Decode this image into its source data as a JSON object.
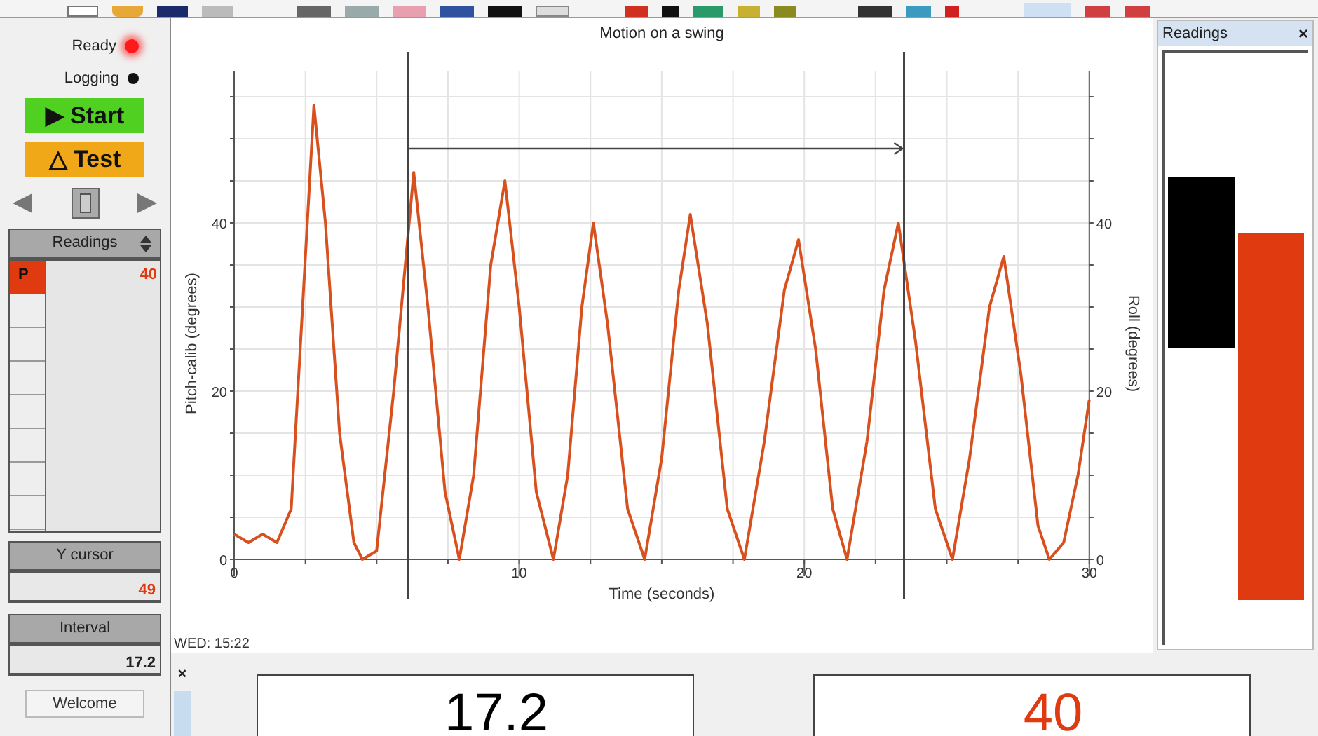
{
  "status_lights": [
    {
      "label": "Ready",
      "on": true
    },
    {
      "label": "Logging",
      "on": false
    }
  ],
  "start_button": {
    "label": "▶ Start"
  },
  "test_button": {
    "label": "△ Test"
  },
  "readings_selector": {
    "label": "Readings"
  },
  "readings_list": [
    {
      "tag": "P",
      "value": "40",
      "color": "#e03a10"
    }
  ],
  "y_cursor": {
    "label": "Y cursor",
    "value": "49"
  },
  "interval": {
    "label": "Interval",
    "value": "17.2"
  },
  "welcome_button": {
    "label": "Welcome"
  },
  "chart_data": {
    "type": "line",
    "title": "Motion on a swing",
    "xlabel": "Time (seconds)",
    "ylabel": "Pitch-calib (degrees)",
    "y2label": "Roll (degrees)",
    "xlim": [
      0,
      30
    ],
    "ylim": [
      0,
      60
    ],
    "xticks": [
      0,
      10,
      20,
      30
    ],
    "yticks": [
      0,
      20,
      40
    ],
    "y2lim": [
      0,
      60
    ],
    "y2ticks": [
      0,
      20,
      40
    ],
    "grid": true,
    "x": [
      0,
      0.5,
      1,
      1.5,
      2,
      2.4,
      2.8,
      3.2,
      3.7,
      4.2,
      4.5,
      5,
      5.6,
      6.3,
      6.8,
      7.4,
      7.9,
      8.4,
      9,
      9.5,
      10,
      10.6,
      11.2,
      11.7,
      12.2,
      12.6,
      13.1,
      13.8,
      14.4,
      15,
      15.6,
      16,
      16.6,
      17.3,
      17.9,
      18.6,
      19.3,
      19.8,
      20.4,
      21,
      21.5,
      22.2,
      22.8,
      23.3,
      23.9,
      24.6,
      25.2,
      25.8,
      26.5,
      27,
      27.6,
      28.2,
      28.6,
      29.1,
      29.6,
      30
    ],
    "series": [
      {
        "color": "#d8501e",
        "values": [
          3,
          2,
          3,
          2,
          6,
          30,
          54,
          40,
          15,
          2,
          0,
          1,
          20,
          46,
          30,
          8,
          0,
          10,
          35,
          45,
          30,
          8,
          0,
          10,
          30,
          40,
          28,
          6,
          0,
          12,
          32,
          41,
          28,
          6,
          0,
          14,
          32,
          38,
          25,
          6,
          0,
          14,
          32,
          40,
          26,
          6,
          0,
          12,
          30,
          36,
          22,
          4,
          0,
          2,
          10,
          19
        ]
      }
    ],
    "ref_lines": [
      {
        "axis": "x",
        "value": 6.1
      },
      {
        "axis": "x",
        "value": 23.5
      }
    ]
  },
  "timestamp": "WED: 15:22",
  "readings_panel": {
    "title": "Readings",
    "close": "×"
  },
  "bottom_close": "×",
  "displays": [
    {
      "value": "17.2",
      "color": "#000000"
    },
    {
      "value": "40",
      "color": "#e03a10"
    }
  ]
}
